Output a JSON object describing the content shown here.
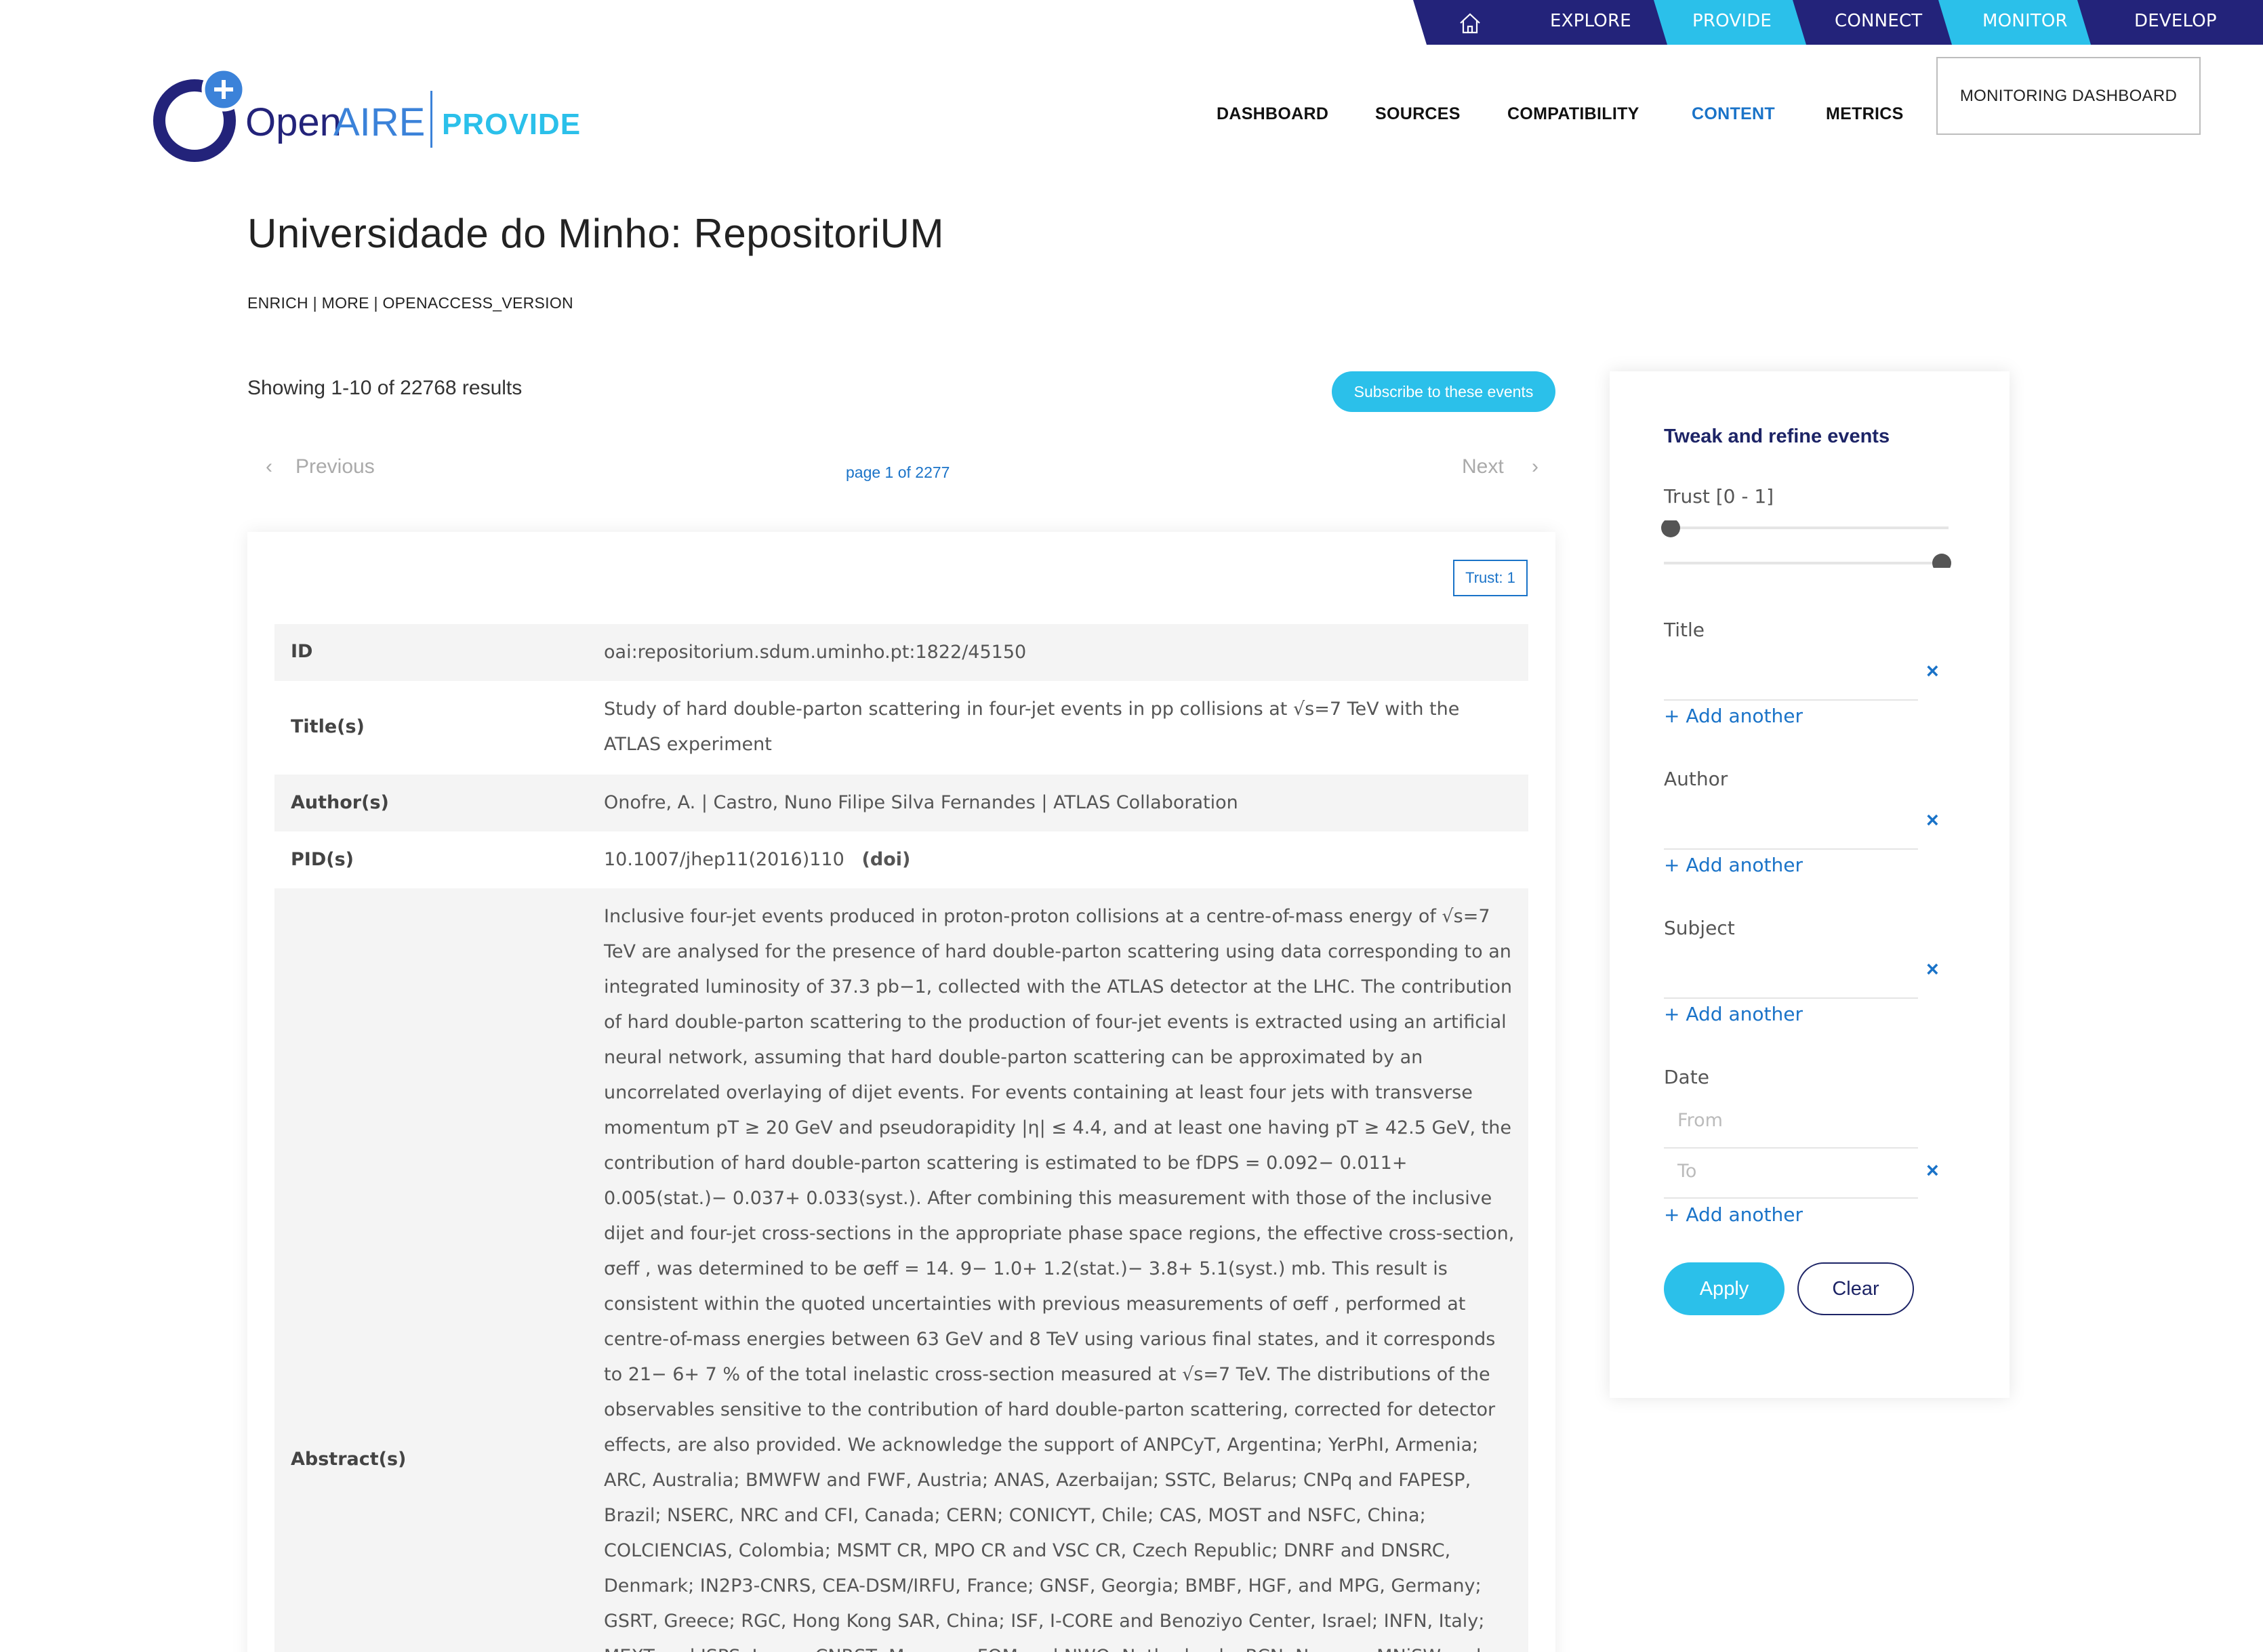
{
  "topnav": {
    "home_icon": "home-icon",
    "items": [
      "EXPLORE",
      "PROVIDE",
      "CONNECT",
      "MONITOR",
      "DEVELOP"
    ],
    "colors": {
      "dark": "#23237a",
      "accent": "#2bc0ea"
    }
  },
  "brand": {
    "logo_open": "Open",
    "logo_aire": "AIRE",
    "logo_provide": "PROVIDE"
  },
  "mainnav": {
    "items": [
      "DASHBOARD",
      "SOURCES",
      "COMPATIBILITY",
      "CONTENT",
      "METRICS"
    ],
    "active": "CONTENT",
    "monitoring_button": "MONITORING DASHBOARD"
  },
  "page": {
    "title": "Universidade do Minho: RepositoriUM",
    "breadcrumb": "ENRICH | MORE | OPENACCESS_VERSION",
    "showing": "Showing 1-10 of 22768 results",
    "subscribe": "Subscribe to these events",
    "previous": "Previous",
    "next": "Next",
    "page_of": "page 1 of 2277"
  },
  "record": {
    "trust": "Trust: 1",
    "id_label": "ID",
    "id_value": "oai:repositorium.sdum.uminho.pt:1822/45150",
    "title_label": "Title(s)",
    "title_value": "Study of hard double-parton scattering in four-jet events in pp collisions at √s=7 TeV with the ATLAS experiment",
    "author_label": "Author(s)",
    "author_value": "Onofre, A. | Castro, Nuno Filipe Silva Fernandes | ATLAS Collaboration",
    "pid_label": "PID(s)",
    "pid_value": "10.1007/jhep11(2016)110",
    "pid_type": "(doi)",
    "abstract_label": "Abstract(s)",
    "abstract_value": "Inclusive four-jet events produced in proton-proton collisions at a centre-of-mass energy of √s=7 TeV are analysed for the presence of hard double-parton scattering using data corresponding to an integrated luminosity of 37.3 pb−1, collected with the ATLAS detector at the LHC. The contribution of hard double-parton scattering to the production of four-jet events is extracted using an artificial neural network, assuming that hard double-parton scattering can be approximated by an uncorrelated overlaying of dijet events. For events containing at least four jets with transverse momentum pT ≥ 20 GeV and pseudorapidity |η| ≤ 4.4, and at least one having pT ≥ 42.5 GeV, the contribution of hard double-parton scattering is estimated to be fDPS = 0.092− 0.011+ 0.005(stat.)− 0.037+ 0.033(syst.). After combining this measurement with those of the inclusive dijet and four-jet cross-sections in the appropriate phase space regions, the effective cross-section, σeff , was determined to be σeff = 14. 9− 1.0+ 1.2(stat.)− 3.8+ 5.1(syst.) mb. This result is consistent within the quoted uncertainties with previous measurements of σeff , performed at centre-of-mass energies between 63 GeV and 8 TeV using various final states, and it corresponds to 21− 6+ 7 % of the total inelastic cross-section measured at √s=7 TeV. The distributions of the observables sensitive to the contribution of hard double-parton scattering, corrected for detector effects, are also provided. We acknowledge the support of ANPCyT, Argentina; YerPhI, Armenia; ARC, Australia; BMWFW and FWF, Austria; ANAS, Azerbaijan; SSTC, Belarus; CNPq and FAPESP, Brazil; NSERC, NRC and CFI, Canada; CERN; CONICYT, Chile; CAS, MOST and NSFC, China; COLCIENCIAS, Colombia; MSMT CR, MPO CR and VSC CR, Czech Republic; DNRF and DNSRC, Denmark; IN2P3-CNRS, CEA-DSM/IRFU, France; GNSF, Georgia; BMBF, HGF, and MPG, Germany; GSRT, Greece; RGC, Hong Kong SAR, China; ISF, I-CORE and Benoziyo Center, Israel; INFN, Italy; MEXT and JSPS, Japan; CNRST, Morocco; FOM and NWO, Netherlands; RCN, Norway; MNiSW and NCN, Poland;"
  },
  "sidebar": {
    "title": "Tweak and refine events",
    "trust_label": "Trust [0 - 1]",
    "trust_range": [
      0,
      1
    ],
    "title_label": "Title",
    "author_label": "Author",
    "subject_label": "Subject",
    "date_label": "Date",
    "from_placeholder": "From",
    "to_placeholder": "To",
    "add_another": "Add another",
    "apply": "Apply",
    "clear": "Clear"
  }
}
